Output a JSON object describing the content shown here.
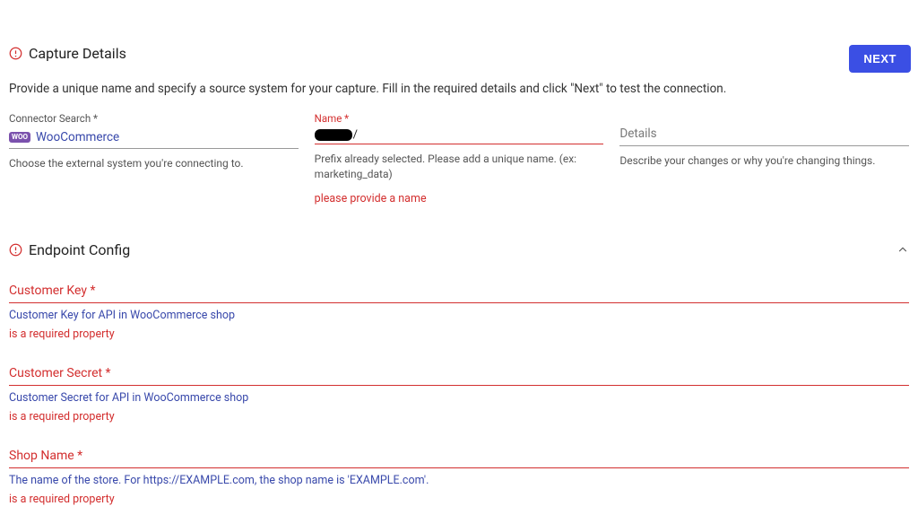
{
  "header": {
    "next_label": "NEXT"
  },
  "capture": {
    "title": "Capture Details",
    "description": "Provide a unique name and specify a source system for your capture. Fill in the required details and click \"Next\" to test the connection.",
    "connector": {
      "label": "Connector Search *",
      "value": "WooCommerce",
      "helper": "Choose the external system you're connecting to."
    },
    "name": {
      "label": "Name *",
      "slash": "/",
      "helper": "Prefix already selected. Please add a unique name. (ex: marketing_data)",
      "error": "please provide a name"
    },
    "details": {
      "placeholder": "Details",
      "helper": "Describe your changes or why you're changing things."
    }
  },
  "endpoint": {
    "title": "Endpoint Config",
    "fields": [
      {
        "label": "Customer Key *",
        "desc": "Customer Key for API in WooCommerce shop",
        "error": "is a required property"
      },
      {
        "label": "Customer Secret *",
        "desc": "Customer Secret for API in WooCommerce shop",
        "error": "is a required property"
      },
      {
        "label": "Shop Name *",
        "desc": "The name of the store. For https://EXAMPLE.com, the shop name is 'EXAMPLE.com'.",
        "error": "is a required property"
      }
    ]
  }
}
